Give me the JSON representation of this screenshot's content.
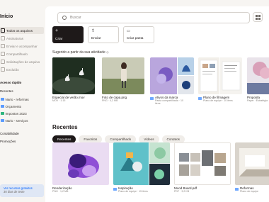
{
  "sidebar": {
    "title": "Início",
    "items": [
      {
        "label": "Todos os arquivos",
        "active": true
      },
      {
        "label": "Assinaturas"
      },
      {
        "label": "Enviar e acompanhar"
      },
      {
        "label": "Compartilhado"
      },
      {
        "label": "Solicitações de arquivo"
      },
      {
        "label": "Excluído"
      }
    ],
    "quick_access_heading": "Acesso rápido",
    "recent_heading": "Recentes",
    "folders": [
      {
        "label": "Nario - reformas",
        "color": "#5b9bff"
      },
      {
        "label": "Orçamento",
        "color": "#5b9bff"
      },
      {
        "label": "Impostos 2023",
        "color": "#2fb57e"
      },
      {
        "label": "Nario - serviços",
        "color": "#5b9bff"
      }
    ],
    "links": [
      "Contabilidade",
      "Promoções"
    ],
    "promo": {
      "line1": "Ver recursos gratuitos",
      "line2": "30 dias de teste"
    }
  },
  "search": {
    "placeholder": "Buscar"
  },
  "actions": [
    {
      "label": "Criar",
      "icon": "plus-icon"
    },
    {
      "label": "Enviar",
      "icon": "upload-icon"
    },
    {
      "label": "Criar pasta",
      "icon": "folder-plus-icon"
    }
  ],
  "suggested": {
    "heading": "Sugerido a partir da sua atividade",
    "items": [
      {
        "name": "Especial de verão.mov",
        "meta": "MOV · 1:15"
      },
      {
        "name": "Foto de capa.png",
        "meta": "PNG · 4,2 MB"
      },
      {
        "name": "Ativos da marca",
        "meta": "Pasta compartilhada · 10 itens"
      },
      {
        "name": "Plano de filmagem",
        "meta": "Plano de equipe · 10 itens"
      },
      {
        "name": "Proposta",
        "meta": "Paper · Estratégia"
      }
    ]
  },
  "recent": {
    "heading": "Recentes",
    "tabs": [
      "Recentes",
      "Favoritos",
      "Compartilhado",
      "Vídeos",
      "Contatos"
    ],
    "items": [
      {
        "name": "Renderização",
        "meta": "PNG · 1,2 MB"
      },
      {
        "name": "Inspiração",
        "meta": "Plano de equipe · 15 itens"
      },
      {
        "name": "Mood Board.pdf",
        "meta": "PDF · 3,2 KB"
      },
      {
        "name": "Reformas",
        "meta": "Plano de equipe"
      }
    ]
  }
}
